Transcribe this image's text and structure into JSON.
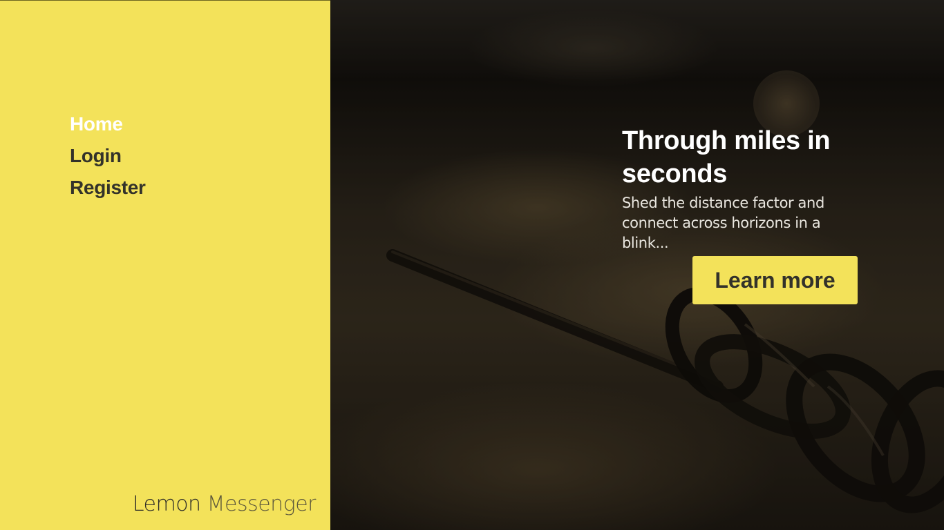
{
  "nav": {
    "items": [
      {
        "label": "Home",
        "active": true
      },
      {
        "label": "Login",
        "active": false
      },
      {
        "label": "Register",
        "active": false
      }
    ]
  },
  "brand": {
    "part1": "Lemon",
    "part2": "Messenger"
  },
  "hero": {
    "title": "Through miles in seconds",
    "subtitle": "Shed the distance factor and connect across horizons in a blink...",
    "cta_label": "Learn more",
    "background_image": "chain-on-ground-photo"
  },
  "colors": {
    "accent": "#f3e25a",
    "nav_text": "#33322a",
    "nav_active": "#ffffff",
    "hero_text": "#ffffff"
  }
}
